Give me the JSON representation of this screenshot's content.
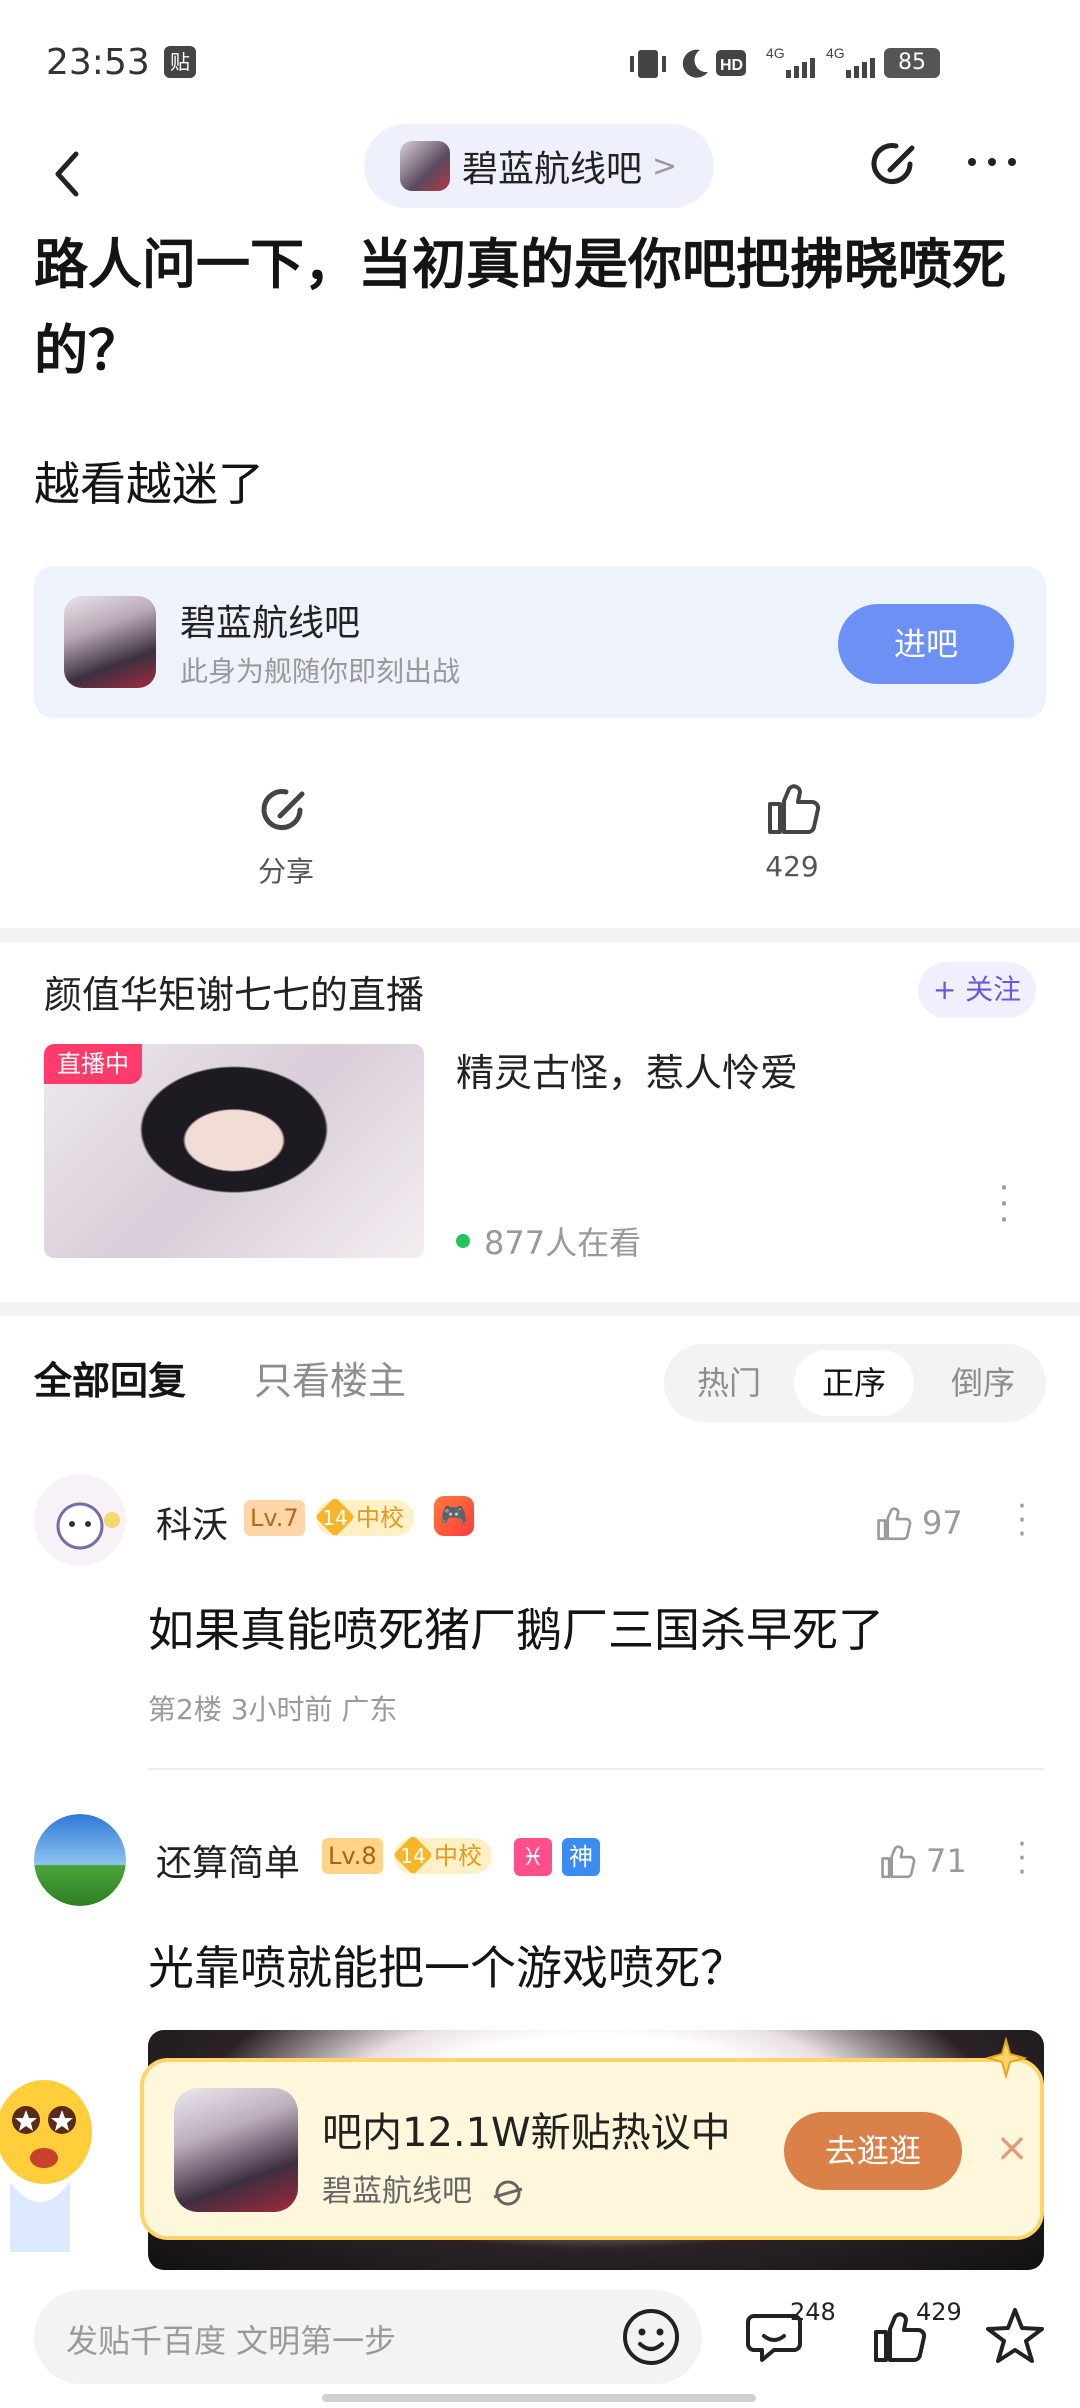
{
  "status": {
    "time": "23:53",
    "tie_icon": "贴",
    "network": [
      "HD",
      "4G",
      "4G"
    ],
    "battery": "85"
  },
  "nav": {
    "forum_name": "碧蓝航线吧",
    "chevron": ">"
  },
  "post": {
    "title": "路人问一下，当初真的是你吧把拂晓喷死的？",
    "body": "越看越迷了"
  },
  "forum_card": {
    "name": "碧蓝航线吧",
    "slogan": "此身为舰随你即刻出战",
    "button": "进吧"
  },
  "actions": {
    "share_label": "分享",
    "like_count": "429"
  },
  "live": {
    "title": "颜值华矩谢七七的直播",
    "follow": "+ 关注",
    "badge": "直播中",
    "desc": "精灵古怪，惹人怜爱",
    "viewers": "877人在看"
  },
  "tabs": {
    "all": "全部回复",
    "op_only": "只看楼主",
    "sort": [
      "热门",
      "正序",
      "倒序"
    ],
    "active_sort": "正序"
  },
  "replies": [
    {
      "name": "科沃",
      "level": "Lv.7",
      "badge_num": "14",
      "badge_label": "中校",
      "likes": "97",
      "text": "如果真能喷死猪厂鹅厂三国杀早死了",
      "meta": "第2楼   3小时前   广东"
    },
    {
      "name": "还算简单",
      "level": "Lv.8",
      "badge_num": "14",
      "badge_label": "中校",
      "extra_badges": [
        "♓",
        "神"
      ],
      "likes": "71",
      "text": "光靠喷就能把一个游戏喷死？"
    }
  ],
  "promo": {
    "title": "吧内12.1W新贴热议中",
    "sub": "碧蓝航线吧",
    "button": "去逛逛",
    "close": "×"
  },
  "bottom": {
    "placeholder": "发贴千百度 文明第一步",
    "comment_count": "248",
    "like_count": "429"
  },
  "colors": {
    "accent_blue": "#6c90f4",
    "live_red": "#ff3b6b",
    "promo_orange": "#d98148"
  }
}
